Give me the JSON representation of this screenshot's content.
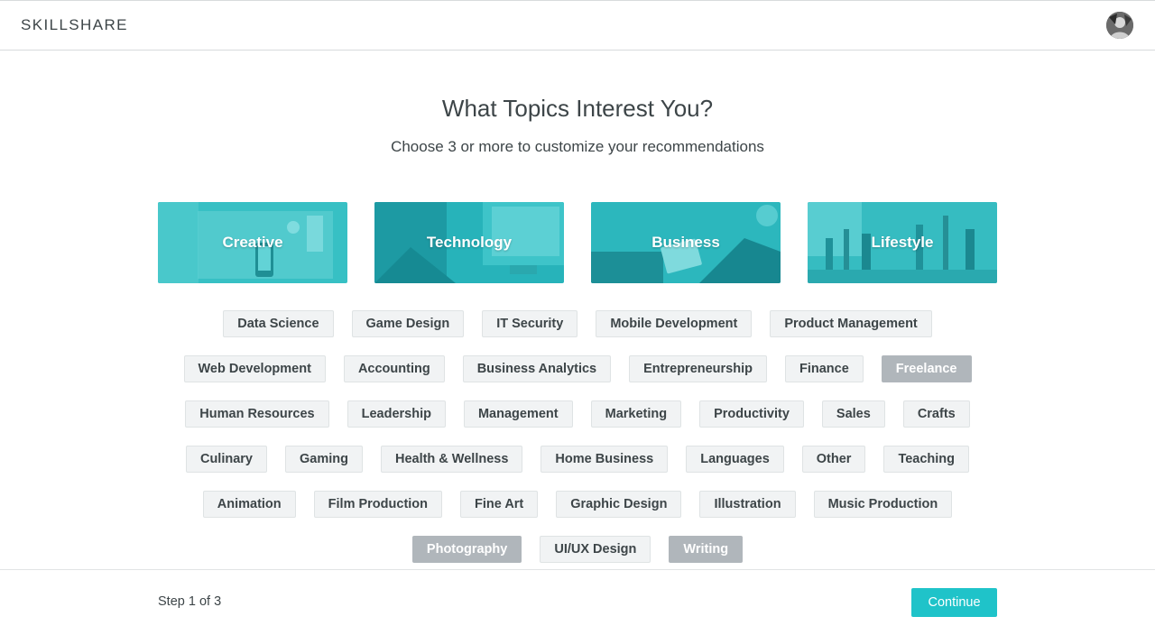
{
  "header": {
    "logo": "SKILLSHARE",
    "avatar": "user-avatar"
  },
  "main": {
    "title": "What Topics Interest You?",
    "subtitle": "Choose 3 or more to customize your recommendations",
    "categories": [
      {
        "label": "Creative"
      },
      {
        "label": "Technology"
      },
      {
        "label": "Business"
      },
      {
        "label": "Lifestyle"
      }
    ],
    "tag_rows": [
      [
        {
          "label": "Data Science",
          "selected": false
        },
        {
          "label": "Game Design",
          "selected": false
        },
        {
          "label": "IT Security",
          "selected": false
        },
        {
          "label": "Mobile Development",
          "selected": false
        },
        {
          "label": "Product Management",
          "selected": false
        }
      ],
      [
        {
          "label": "Web Development",
          "selected": false
        },
        {
          "label": "Accounting",
          "selected": false
        },
        {
          "label": "Business Analytics",
          "selected": false
        },
        {
          "label": "Entrepreneurship",
          "selected": false
        },
        {
          "label": "Finance",
          "selected": false
        },
        {
          "label": "Freelance",
          "selected": true
        }
      ],
      [
        {
          "label": "Human Resources",
          "selected": false
        },
        {
          "label": "Leadership",
          "selected": false
        },
        {
          "label": "Management",
          "selected": false
        },
        {
          "label": "Marketing",
          "selected": false
        },
        {
          "label": "Productivity",
          "selected": false
        },
        {
          "label": "Sales",
          "selected": false
        },
        {
          "label": "Crafts",
          "selected": false
        }
      ],
      [
        {
          "label": "Culinary",
          "selected": false
        },
        {
          "label": "Gaming",
          "selected": false
        },
        {
          "label": "Health & Wellness",
          "selected": false
        },
        {
          "label": "Home Business",
          "selected": false
        },
        {
          "label": "Languages",
          "selected": false
        },
        {
          "label": "Other",
          "selected": false
        },
        {
          "label": "Teaching",
          "selected": false
        }
      ],
      [
        {
          "label": "Animation",
          "selected": false
        },
        {
          "label": "Film Production",
          "selected": false
        },
        {
          "label": "Fine Art",
          "selected": false
        },
        {
          "label": "Graphic Design",
          "selected": false
        },
        {
          "label": "Illustration",
          "selected": false
        },
        {
          "label": "Music Production",
          "selected": false
        }
      ],
      [
        {
          "label": "Photography",
          "selected": true
        },
        {
          "label": "UI/UX Design",
          "selected": false
        },
        {
          "label": "Writing",
          "selected": true
        }
      ]
    ]
  },
  "footer": {
    "step": "Step 1 of 3",
    "continue_label": "Continue"
  },
  "colors": {
    "accent": "#1fc3c9",
    "category_overlay": "#2bbfc4",
    "tag_bg": "#f1f3f4",
    "tag_selected_bg": "#b0b6bb",
    "text": "#3d4548"
  }
}
